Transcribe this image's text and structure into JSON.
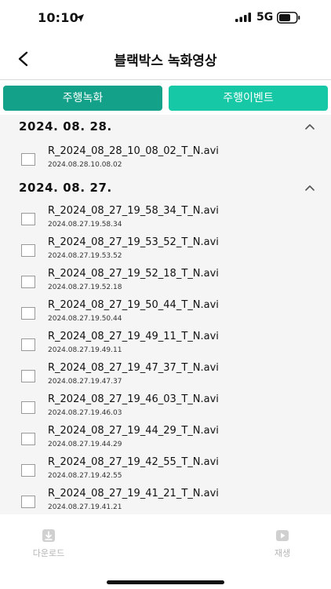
{
  "status_bar": {
    "time": "10:10",
    "network": "5G"
  },
  "header": {
    "title": "블랙박스 녹화영상"
  },
  "tabs": [
    {
      "label": "주행녹화",
      "color": "#14a189"
    },
    {
      "label": "주행이벤트",
      "color": "#17c8a7"
    }
  ],
  "groups": [
    {
      "date": "2024. 08. 28.",
      "items": [
        {
          "name": "R_2024_08_28_10_08_02_T_N.avi",
          "time": "2024.08.28.10.08.02"
        }
      ]
    },
    {
      "date": "2024. 08. 27.",
      "items": [
        {
          "name": "R_2024_08_27_19_58_34_T_N.avi",
          "time": "2024.08.27.19.58.34"
        },
        {
          "name": "R_2024_08_27_19_53_52_T_N.avi",
          "time": "2024.08.27.19.53.52"
        },
        {
          "name": "R_2024_08_27_19_52_18_T_N.avi",
          "time": "2024.08.27.19.52.18"
        },
        {
          "name": "R_2024_08_27_19_50_44_T_N.avi",
          "time": "2024.08.27.19.50.44"
        },
        {
          "name": "R_2024_08_27_19_49_11_T_N.avi",
          "time": "2024.08.27.19.49.11"
        },
        {
          "name": "R_2024_08_27_19_47_37_T_N.avi",
          "time": "2024.08.27.19.47.37"
        },
        {
          "name": "R_2024_08_27_19_46_03_T_N.avi",
          "time": "2024.08.27.19.46.03"
        },
        {
          "name": "R_2024_08_27_19_44_29_T_N.avi",
          "time": "2024.08.27.19.44.29"
        },
        {
          "name": "R_2024_08_27_19_42_55_T_N.avi",
          "time": "2024.08.27.19.42.55"
        },
        {
          "name": "R_2024_08_27_19_41_21_T_N.avi",
          "time": "2024.08.27.19.41.21"
        }
      ]
    }
  ],
  "bottom_bar": {
    "download_label": "다운로드",
    "play_label": "재생"
  }
}
